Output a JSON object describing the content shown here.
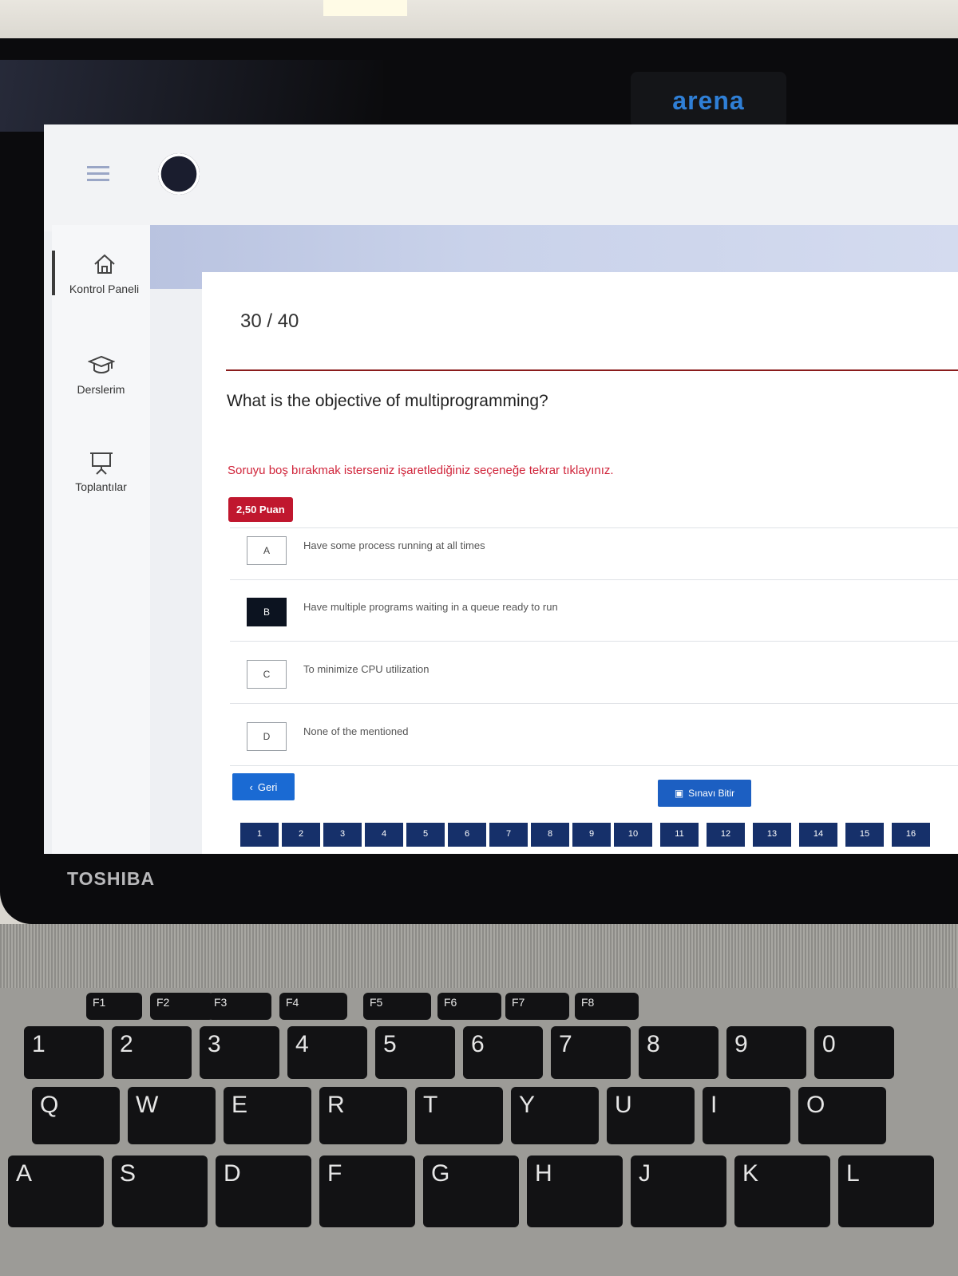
{
  "environment": {
    "webcam_brand": "arena",
    "laptop_brand": "TOSHIBA"
  },
  "sidebar": {
    "items": [
      {
        "label": "Kontrol Paneli",
        "icon": "home-icon"
      },
      {
        "label": "Derslerim",
        "icon": "graduation-cap-icon"
      },
      {
        "label": "Toplantılar",
        "icon": "presentation-board-icon"
      }
    ]
  },
  "exam": {
    "counter": "30 / 40",
    "question": "What is the objective of multiprogramming?",
    "hint": "Soruyu boş bırakmak isterseniz işaretlediğiniz seçeneğe tekrar tıklayınız.",
    "points": "2,50 Puan",
    "options": [
      {
        "letter": "A",
        "text": "Have some process running at all times",
        "selected": false
      },
      {
        "letter": "B",
        "text": "Have multiple programs waiting in a queue ready to run",
        "selected": true
      },
      {
        "letter": "C",
        "text": "To minimize CPU utilization",
        "selected": false
      },
      {
        "letter": "D",
        "text": "None of the mentioned",
        "selected": false
      }
    ],
    "back_label": "Geri",
    "finish_label": "Sınavı Bitir",
    "pages": [
      "1",
      "2",
      "3",
      "4",
      "5",
      "6",
      "7",
      "8",
      "9",
      "10",
      "11",
      "12",
      "13",
      "14",
      "15",
      "16"
    ]
  },
  "colors": {
    "accent_red": "#c0172e",
    "primary_blue": "#1a6ad3",
    "pager_navy": "#16306a",
    "selected_option": "#0c1320"
  }
}
